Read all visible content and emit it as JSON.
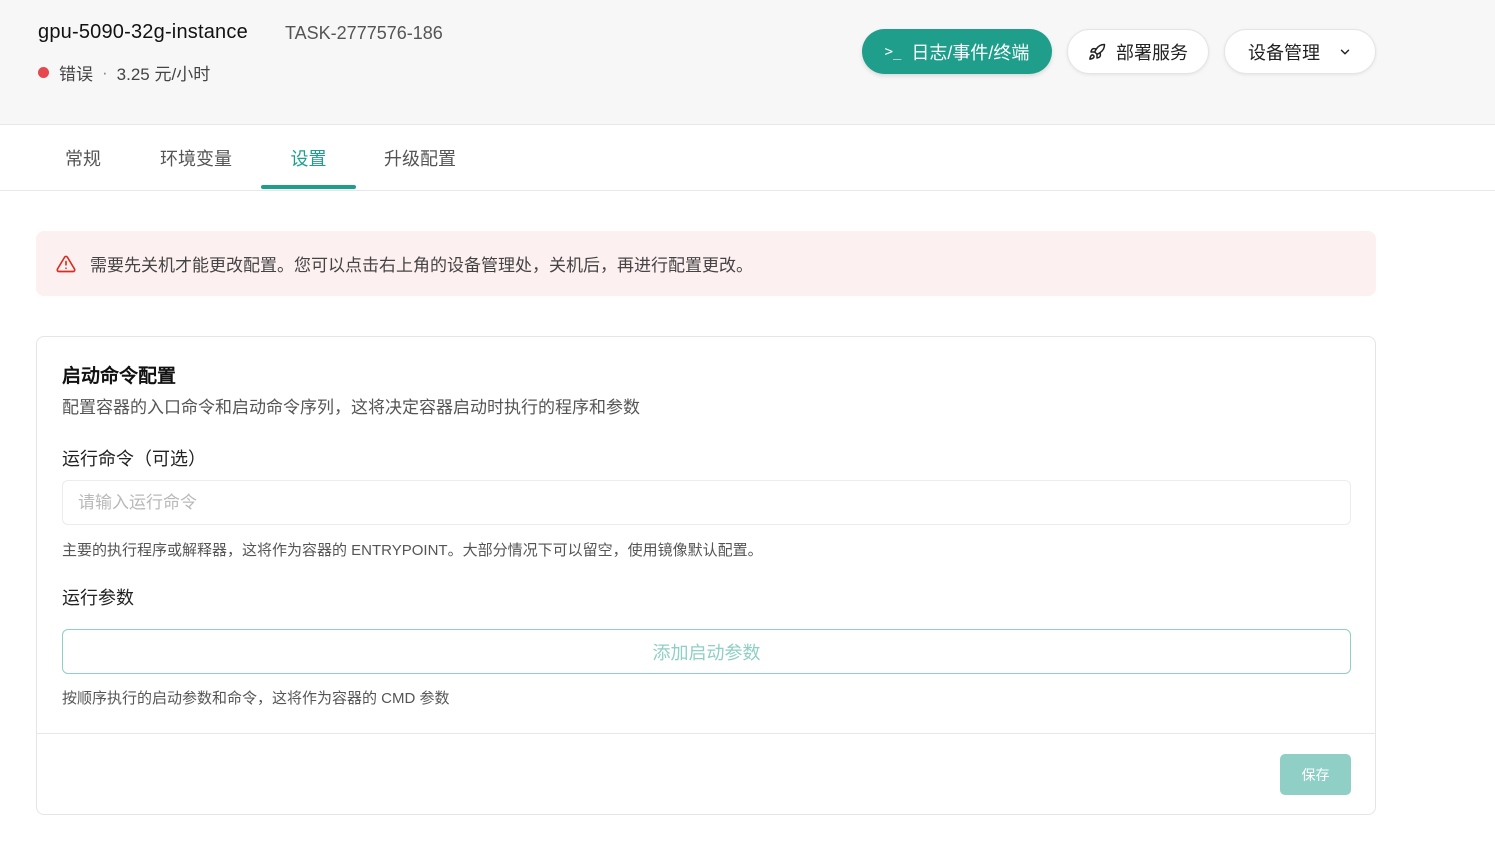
{
  "instance": {
    "name": "gpu-5090-32g-instance",
    "task_id": "TASK-2777576-186",
    "status": "错误",
    "separator": "·",
    "price": "3.25 元/小时",
    "status_color": "#e5484d"
  },
  "actions": {
    "logs_label": "日志/事件/终端",
    "logs_icon": "terminal-icon",
    "deploy_label": "部署服务",
    "deploy_icon": "rocket-icon",
    "device_label": "设备管理",
    "device_icon": "chevron-down-icon"
  },
  "tabs": [
    {
      "label": "常规",
      "active": false
    },
    {
      "label": "环境变量",
      "active": false
    },
    {
      "label": "设置",
      "active": true
    },
    {
      "label": "升级配置",
      "active": false
    }
  ],
  "alert": {
    "icon": "warning-triangle-icon",
    "text": "需要先关机才能更改配置。您可以点击右上角的设备管理处，关机后，再进行配置更改。"
  },
  "startup": {
    "title": "启动命令配置",
    "description": "配置容器的入口命令和启动命令序列，这将决定容器启动时执行的程序和参数",
    "command_label": "运行命令（可选）",
    "command_value": "",
    "command_placeholder": "请输入运行命令",
    "command_hint": "主要的执行程序或解释器，这将作为容器的 ENTRYPOINT。大部分情况下可以留空，使用镜像默认配置。",
    "args_label": "运行参数",
    "add_args_label": "添加启动参数",
    "args_hint": "按顺序执行的启动参数和命令，这将作为容器的 CMD 参数",
    "save_label": "保存"
  },
  "colors": {
    "accent": "#1f9e8c",
    "accent_light": "#8fcfc5",
    "alert_bg": "#fdf0f0",
    "alert_icon": "#d92d20"
  }
}
